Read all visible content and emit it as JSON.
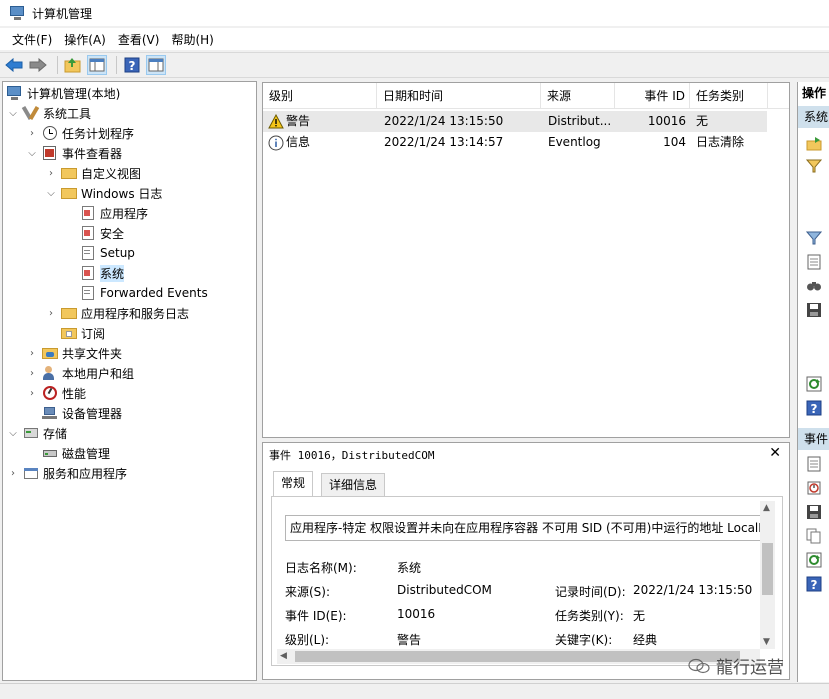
{
  "window": {
    "title": "计算机管理"
  },
  "menu": [
    "文件(F)",
    "操作(A)",
    "查看(V)",
    "帮助(H)"
  ],
  "tree": {
    "root": "计算机管理(本地)",
    "system_tools": "系统工具",
    "task_scheduler": "任务计划程序",
    "event_viewer": "事件查看器",
    "custom_views": "自定义视图",
    "windows_logs": "Windows 日志",
    "application": "应用程序",
    "security": "安全",
    "setup": "Setup",
    "system": "系统",
    "forwarded_events": "Forwarded Events",
    "app_service_logs": "应用程序和服务日志",
    "subscriptions": "订阅",
    "shared_folders": "共享文件夹",
    "local_users_groups": "本地用户和组",
    "performance": "性能",
    "device_manager": "设备管理器",
    "storage": "存储",
    "disk_management": "磁盘管理",
    "services_apps": "服务和应用程序"
  },
  "list": {
    "columns": [
      "级别",
      "日期和时间",
      "来源",
      "事件 ID",
      "任务类别"
    ],
    "rows": [
      {
        "level": "警告",
        "datetime": "2022/1/24 13:15:50",
        "source": "Distribut...",
        "event_id": "10016",
        "task": "无",
        "icon": "warning-icon"
      },
      {
        "level": "信息",
        "datetime": "2022/1/24 13:14:57",
        "source": "Eventlog",
        "event_id": "104",
        "task": "日志清除",
        "icon": "info-icon"
      }
    ]
  },
  "detail": {
    "title": "事件 10016，DistributedCOM",
    "tabs": [
      "常规",
      "详细信息"
    ],
    "description": "应用程序-特定 权限设置并未向在应用程序容器 不可用 SID (不可用)中运行的地址 LocalHost",
    "log_name_label": "日志名称(M):",
    "log_name_value": "系统",
    "source_label": "来源(S):",
    "source_value": "DistributedCOM",
    "logged_label": "记录时间(D):",
    "logged_value": "2022/1/24 13:15:50",
    "event_id_label": "事件 ID(E):",
    "event_id_value": "10016",
    "task_label": "任务类别(Y):",
    "task_value": "无",
    "level_label": "级别(L):",
    "level_value": "警告",
    "keywords_label": "关键字(K):",
    "keywords_value": "经典"
  },
  "actions": {
    "header": "操作",
    "section1": "系统",
    "section2": "事件"
  },
  "watermark": "龍行运营"
}
